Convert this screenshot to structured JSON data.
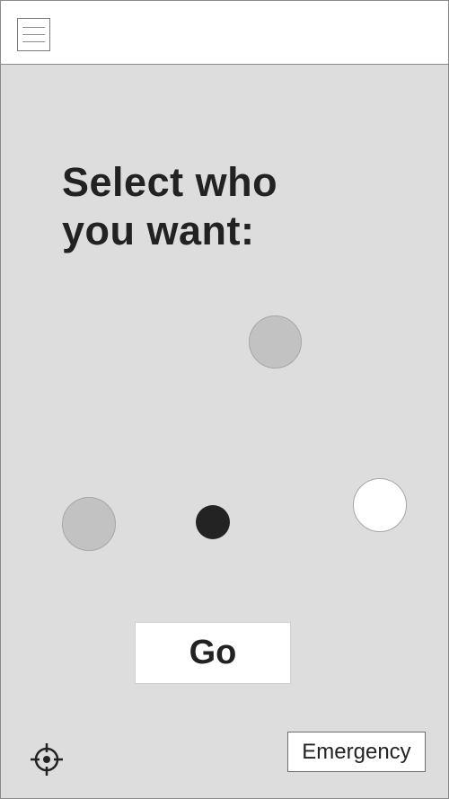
{
  "header": {
    "menu_icon": "hamburger-menu-icon"
  },
  "main": {
    "title_line1": "Select who",
    "title_line2": "you want:",
    "people": [
      {
        "state": "available",
        "color": "#c2c2c2"
      },
      {
        "state": "available",
        "color": "#c2c2c2"
      },
      {
        "state": "selected",
        "color": "#232323"
      },
      {
        "state": "unselected",
        "color": "#ffffff"
      }
    ],
    "go_label": "Go"
  },
  "footer": {
    "location_icon": "crosshair-location-icon",
    "emergency_label": "Emergency"
  },
  "colors": {
    "background": "#dddddd",
    "panel": "#ffffff",
    "text": "#222222",
    "border": "#8a8a8a"
  }
}
